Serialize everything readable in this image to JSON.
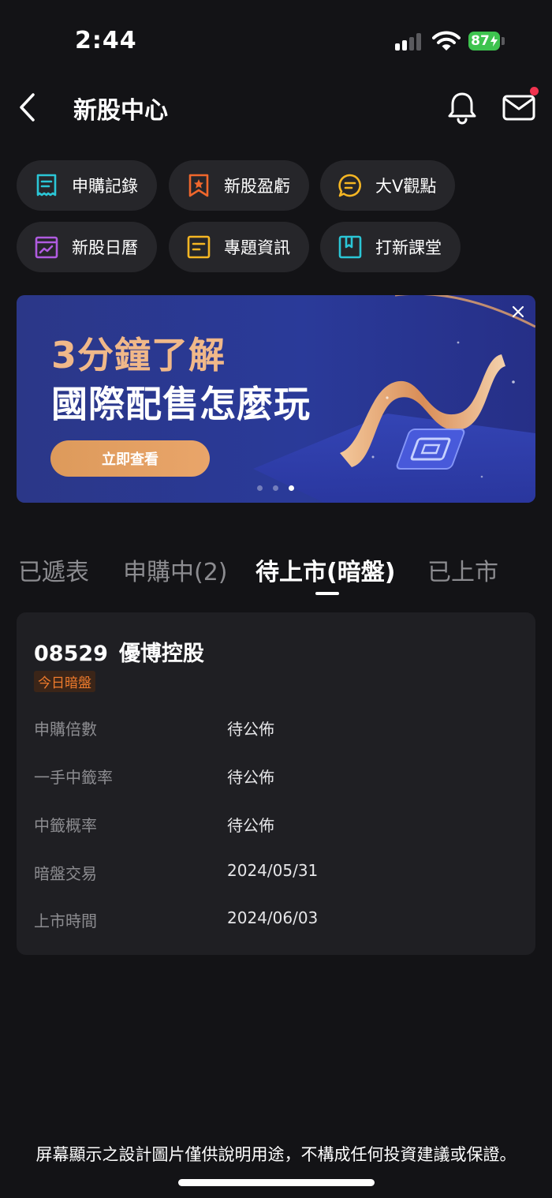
{
  "status_bar": {
    "time": "2:44",
    "battery": "87"
  },
  "nav": {
    "title": "新股中心"
  },
  "quick_menu": [
    {
      "label": "申購記錄",
      "icon": "receipt-icon",
      "color": "#2bc6d6"
    },
    {
      "label": "新股盈虧",
      "icon": "star-bookmark-icon",
      "color": "#f0672c"
    },
    {
      "label": "大V觀點",
      "icon": "chat-bubble-icon",
      "color": "#f5b623"
    },
    {
      "label": "新股日曆",
      "icon": "calendar-chart-icon",
      "color": "#b05be0"
    },
    {
      "label": "專題資訊",
      "icon": "document-icon",
      "color": "#f5b623"
    },
    {
      "label": "打新課堂",
      "icon": "book-icon",
      "color": "#2bc6d6"
    }
  ],
  "banner": {
    "line1": "3分鐘了解",
    "line2": "國際配售怎麼玩",
    "button": "立即查看",
    "page_count": 3,
    "active_page": 3
  },
  "tabs": [
    {
      "label": "已遞表",
      "active": false
    },
    {
      "label": "申購中(2)",
      "active": false
    },
    {
      "label": "待上市(暗盤)",
      "active": true
    },
    {
      "label": "已上市",
      "active": false
    }
  ],
  "stock_card": {
    "code": "08529",
    "name": "優博控股",
    "badge": "今日暗盤",
    "rows": [
      {
        "label": "申購倍數",
        "value": "待公佈"
      },
      {
        "label": "一手中籤率",
        "value": "待公佈"
      },
      {
        "label": "中籤概率",
        "value": "待公佈"
      },
      {
        "label": "暗盤交易",
        "value": "2024/05/31"
      },
      {
        "label": "上市時間",
        "value": "2024/06/03"
      }
    ]
  },
  "footer": {
    "disclaimer": "屏幕顯示之設計圖片僅供說明用途，不構成任何投資建議或保證。"
  },
  "colors": {
    "background": "#131316",
    "card": "#1f1f23",
    "chip": "#26262a",
    "accent_orange": "#e9a56a",
    "badge_text": "#f07b2c",
    "notification_dot": "#f0334f"
  }
}
